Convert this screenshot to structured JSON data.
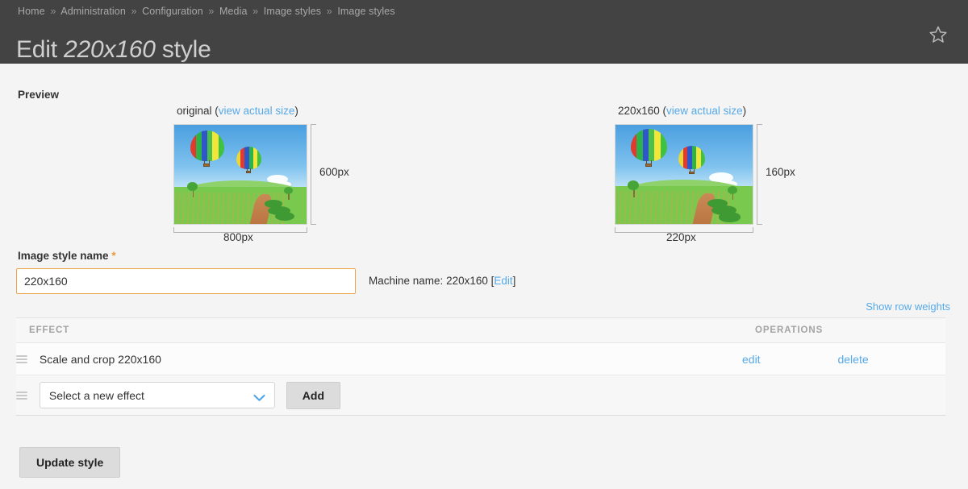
{
  "header": {
    "breadcrumb": [
      "Home",
      "Administration",
      "Configuration",
      "Media",
      "Image styles",
      "Image styles"
    ],
    "breadcrumb_separator": "»",
    "title_prefix": "Edit ",
    "title_emphasis": "220x160",
    "title_suffix": " style",
    "star_icon": "star-outline-icon",
    "bg_color": "#434343"
  },
  "preview": {
    "heading": "Preview",
    "original": {
      "label": "original (",
      "link_text": "view actual size",
      "label_end": ")",
      "width_label": "800px",
      "height_label": "600px"
    },
    "styled": {
      "label": "220x160 (",
      "link_text": "view actual size",
      "label_end": ")",
      "width_label": "220px",
      "height_label": "160px"
    }
  },
  "form": {
    "name_label": "Image style name",
    "required_marker": "*",
    "name_value": "220x160",
    "name_placeholder": "Image style name",
    "machine_name_prefix": "Machine name: ",
    "machine_name_value": "220x160",
    "machine_name_bracket_open": " [",
    "machine_name_edit": "Edit",
    "machine_name_bracket_close": "]",
    "input_border_color": "#eaa54a"
  },
  "table": {
    "show_row_weights": "Show row weights",
    "columns": [
      "EFFECT",
      "OPERATIONS"
    ],
    "rows": [
      {
        "drag_handle": "drag-handle-icon",
        "effect": "Scale and crop 220x160",
        "edit": "edit",
        "delete": "delete"
      }
    ],
    "new_effect": {
      "drag_handle": "drag-handle-icon",
      "selected_option": "Select a new effect",
      "options": [
        "Select a new effect"
      ],
      "chevron_icon": "chevron-down-icon",
      "add_label": "Add"
    }
  },
  "actions": {
    "update_label": "Update style"
  },
  "colors": {
    "link": "#56a9e8",
    "accent": "#eaa54a",
    "page_bg": "#f4f4f4"
  }
}
